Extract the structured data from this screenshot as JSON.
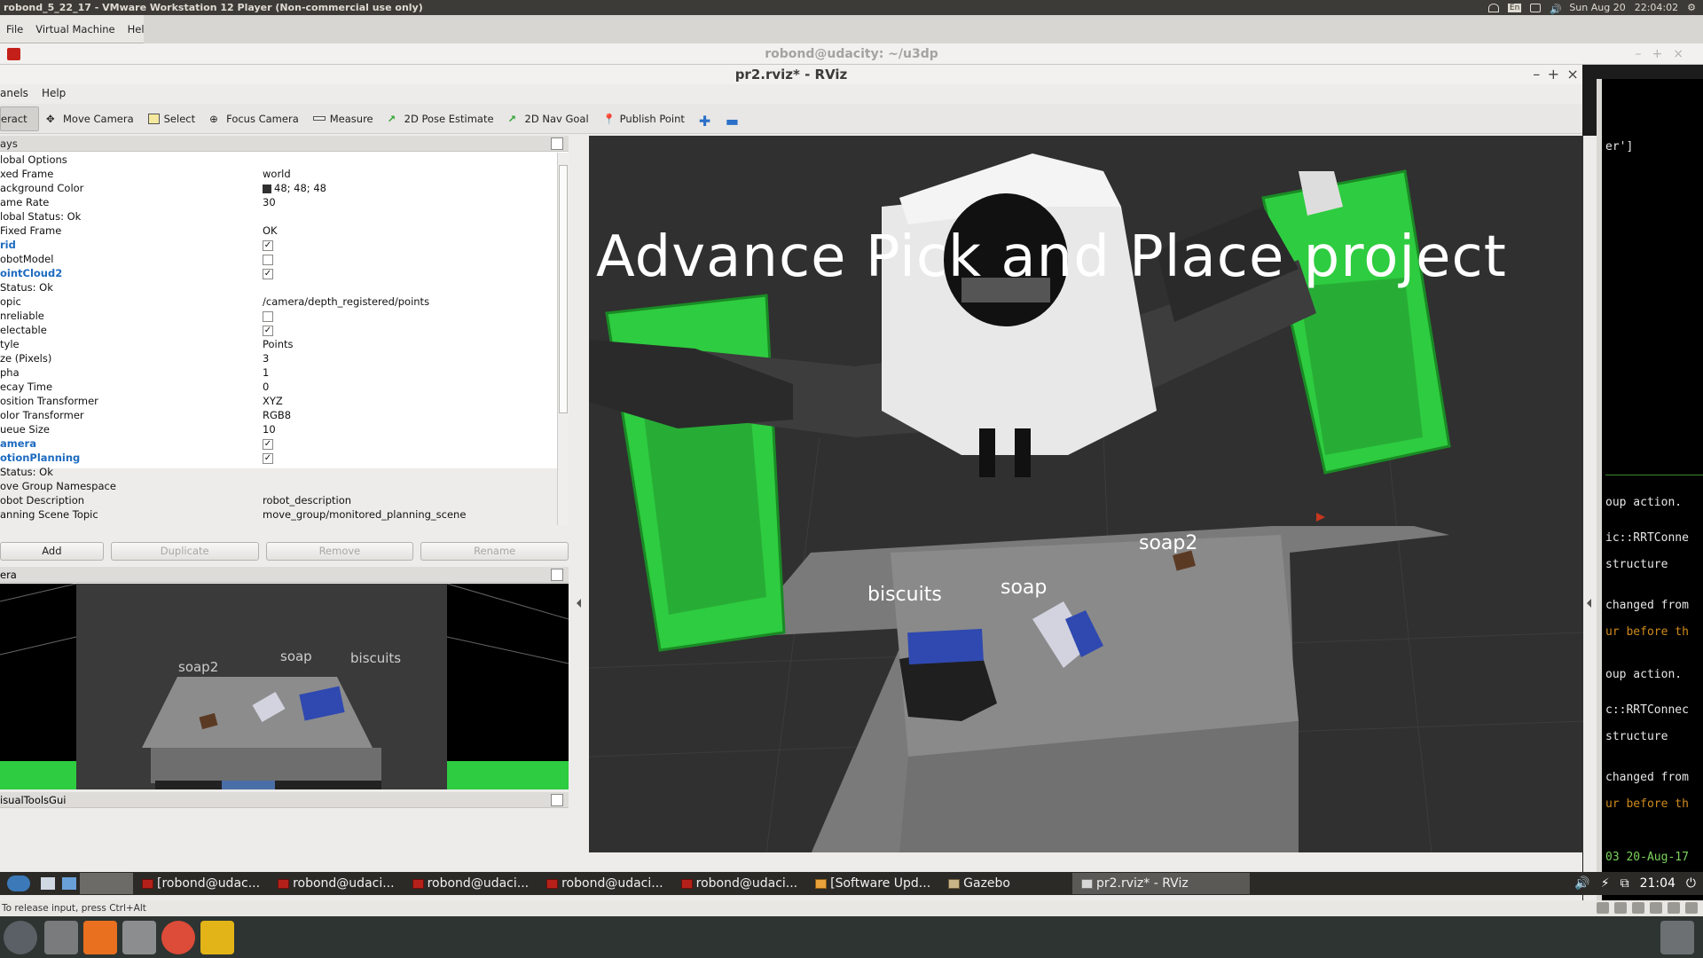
{
  "host": {
    "window_title": "robond_5_22_17 - VMware Workstation 12 Player (Non-commercial use only)",
    "date": "Sun Aug 20",
    "time": "22:04:02",
    "keyboard": "En"
  },
  "vm_menu": [
    "File",
    "Virtual Machine",
    "Help"
  ],
  "terminal": {
    "title": "robond@udacity: ~/u3dp",
    "lines": [
      {
        "text": "er']",
        "style": "white"
      },
      {
        "text": "oup action.",
        "style": "white"
      },
      {
        "text": "ic::RRTConne",
        "style": "white"
      },
      {
        "text": "structure",
        "style": "white"
      },
      {
        "text": "changed from",
        "style": "white"
      },
      {
        "text": "ur before th",
        "style": "orange"
      },
      {
        "text": "oup action.",
        "style": "white"
      },
      {
        "text": "c::RRTConnec",
        "style": "white"
      },
      {
        "text": "structure",
        "style": "white"
      },
      {
        "text": "changed from",
        "style": "white"
      },
      {
        "text": "ur before th",
        "style": "orange"
      },
      {
        "text": "03 20-Aug-17",
        "style": "green"
      }
    ]
  },
  "rviz": {
    "title": "pr2.rviz* - RViz",
    "menu": [
      "anels",
      "Help"
    ],
    "toolbar": [
      {
        "label": "eract",
        "icon": "interact-icon",
        "active": true
      },
      {
        "label": "Move Camera",
        "icon": "move-camera-icon",
        "active": false
      },
      {
        "label": "Select",
        "icon": "select-icon",
        "active": false
      },
      {
        "label": "Focus Camera",
        "icon": "focus-camera-icon",
        "active": false
      },
      {
        "label": "Measure",
        "icon": "measure-icon",
        "active": false
      },
      {
        "label": "2D Pose Estimate",
        "icon": "pose-estimate-icon",
        "active": false
      },
      {
        "label": "2D Nav Goal",
        "icon": "nav-goal-icon",
        "active": false
      },
      {
        "label": "Publish Point",
        "icon": "publish-point-icon",
        "active": false
      }
    ],
    "displays_title": "ays",
    "displays": [
      {
        "key": "lobal Options",
        "value": ""
      },
      {
        "key": "xed Frame",
        "value": "world"
      },
      {
        "key": "ackground Color",
        "value": "48; 48; 48",
        "swatch": "#303030"
      },
      {
        "key": "ame Rate",
        "value": "30"
      },
      {
        "key": "lobal Status: Ok",
        "value": ""
      },
      {
        "key": "  Fixed Frame",
        "value": "OK"
      },
      {
        "key": "rid",
        "value": "",
        "check": "checked",
        "blue": true
      },
      {
        "key": "obotModel",
        "value": "",
        "check": "unchecked"
      },
      {
        "key": "ointCloud2",
        "value": "",
        "check": "checked",
        "blue": true
      },
      {
        "key": "  Status: Ok",
        "value": ""
      },
      {
        "key": "opic",
        "value": "/camera/depth_registered/points"
      },
      {
        "key": "nreliable",
        "value": "",
        "check": "unchecked"
      },
      {
        "key": "electable",
        "value": "",
        "check": "checked"
      },
      {
        "key": "tyle",
        "value": "Points"
      },
      {
        "key": "ze (Pixels)",
        "value": "3"
      },
      {
        "key": "pha",
        "value": "1"
      },
      {
        "key": "ecay Time",
        "value": "0"
      },
      {
        "key": "osition Transformer",
        "value": "XYZ"
      },
      {
        "key": "olor Transformer",
        "value": "RGB8"
      },
      {
        "key": "ueue Size",
        "value": "10"
      },
      {
        "key": "amera",
        "value": "",
        "check": "checked",
        "blue": true
      },
      {
        "key": "otionPlanning",
        "value": "",
        "check": "checked",
        "blue": true
      },
      {
        "key": "  Status: Ok",
        "value": ""
      },
      {
        "key": "ove Group Namespace",
        "value": ""
      },
      {
        "key": "obot Description",
        "value": "robot_description"
      },
      {
        "key": "anning Scene Topic",
        "value": "move_group/monitored_planning_scene"
      }
    ],
    "buttons": {
      "add": "Add",
      "duplicate": "Duplicate",
      "remove": "Remove",
      "rename": "Rename"
    },
    "camera_title": "era",
    "camera_labels": {
      "soap2": "soap2",
      "soap": "soap",
      "biscuits": "biscuits"
    },
    "mvtg_title": "isualToolsGui",
    "view": {
      "overlay": "Advance  Pick  and  Place project",
      "labels": {
        "soap2": "soap2",
        "soap": "soap",
        "biscuits": "biscuits"
      }
    }
  },
  "taskbar": {
    "items": [
      {
        "label": "[robond@udac...",
        "icon": "terminal-icon",
        "active": false
      },
      {
        "label": "robond@udaci...",
        "icon": "terminal-icon",
        "active": false
      },
      {
        "label": "robond@udaci...",
        "icon": "terminal-icon",
        "active": false
      },
      {
        "label": "robond@udaci...",
        "icon": "terminal-icon",
        "active": false
      },
      {
        "label": "robond@udaci...",
        "icon": "terminal-icon",
        "active": false
      },
      {
        "label": "[Software Upd...",
        "icon": "update-icon",
        "active": false
      },
      {
        "label": "Gazebo",
        "icon": "gazebo-icon",
        "active": false
      },
      {
        "label": "pr2.rviz* - RViz",
        "icon": "rviz-icon",
        "active": true
      }
    ],
    "clock": "21:04"
  },
  "vm_status": "To release input, press Ctrl+Alt"
}
